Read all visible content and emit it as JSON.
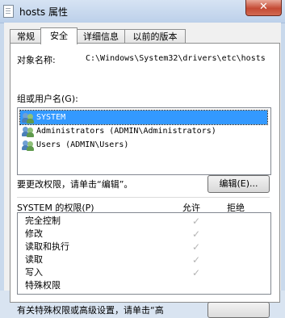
{
  "window": {
    "title": "hosts 属性",
    "close_glyph": "✕"
  },
  "tabs": [
    {
      "label": "常规"
    },
    {
      "label": "安全",
      "active": true
    },
    {
      "label": "详细信息"
    },
    {
      "label": "以前的版本"
    }
  ],
  "object": {
    "label": "对象名称:",
    "value": "C:\\Windows\\System32\\drivers\\etc\\hosts"
  },
  "groups": {
    "label": "组或用户名(G):",
    "items": [
      {
        "name": "SYSTEM",
        "selected": true,
        "icon": "users-icon"
      },
      {
        "name": "Administrators (ADMIN\\Administrators)",
        "icon": "users-icon"
      },
      {
        "name": "Users (ADMIN\\Users)",
        "icon": "users-icon"
      }
    ]
  },
  "change_hint": "要更改权限，请单击“编辑”。",
  "edit_button": "编辑(E)...",
  "permissions": {
    "title": "SYSTEM 的权限(P)",
    "allow_header": "允许",
    "deny_header": "拒绝",
    "rows": [
      {
        "name": "完全控制",
        "allow": "✓"
      },
      {
        "name": "修改",
        "allow": "✓"
      },
      {
        "name": "读取和执行",
        "allow": "✓"
      },
      {
        "name": "读取",
        "allow": "✓"
      },
      {
        "name": "写入",
        "allow": "✓"
      },
      {
        "name": "特殊权限",
        "allow": ""
      }
    ]
  },
  "footer_text": "有关特殊权限或高级设置，请单击“高"
}
